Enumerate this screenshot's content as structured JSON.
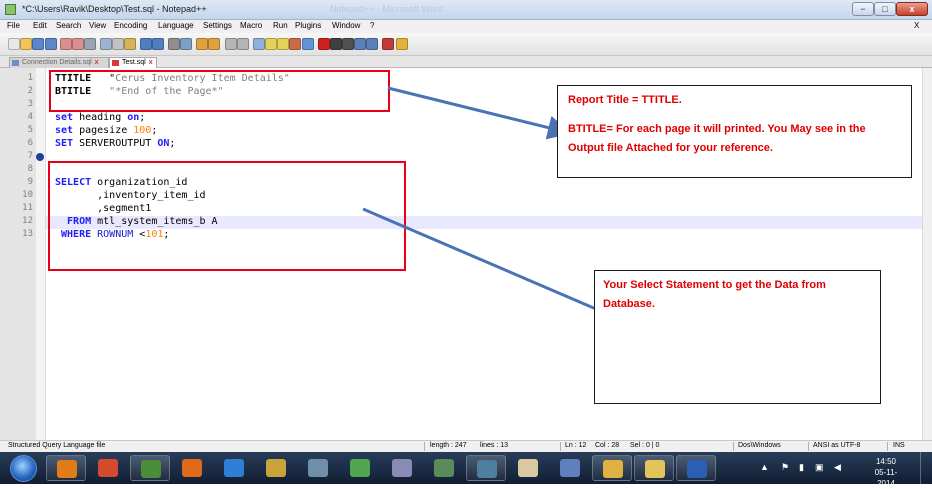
{
  "window": {
    "title": "*C:\\Users\\Ravik\\Desktop\\Test.sql - Notepad++",
    "background_title": "Notepad++ - Microsoft Word",
    "min_label": "−",
    "max_label": "□",
    "close_label": "x",
    "doc_close_label": "X"
  },
  "menu": [
    "File",
    "Edit",
    "Search",
    "View",
    "Encoding",
    "Language",
    "Settings",
    "Macro",
    "Run",
    "Plugins",
    "Window",
    "?"
  ],
  "toolbar_icons": [
    "new-file-icon",
    "open-file-icon",
    "save-icon",
    "save-all-icon",
    "close-icon",
    "close-all-icon",
    "print-icon",
    "cut-icon",
    "copy-icon",
    "paste-icon",
    "undo-icon",
    "redo-icon",
    "find-icon",
    "replace-icon",
    "zoom-in-icon",
    "zoom-out-icon",
    "sync-vertical-icon",
    "sync-horizontal-icon",
    "word-wrap-icon",
    "show-all-chars-icon",
    "indent-guide-icon",
    "document-map-icon",
    "function-list-icon",
    "record-macro-icon",
    "stop-record-icon",
    "play-macro-icon",
    "run-macro-multiple-icon",
    "save-macro-icon",
    "spell-check-icon",
    "color-picker-icon"
  ],
  "tabs": [
    {
      "label": "Connection Details.sql",
      "state": "inactive",
      "close": "x"
    },
    {
      "label": "Test.sql",
      "state": "active",
      "close": "x"
    }
  ],
  "editor": {
    "line_numbers": [
      "1",
      "2",
      "3",
      "4",
      "5",
      "6",
      "7",
      "8",
      "9",
      "10",
      "11",
      "12",
      "13"
    ],
    "lines": [
      [
        {
          "t": "TTITLE",
          "c": "bold"
        },
        {
          "t": "   \"",
          "c": ""
        },
        {
          "t": "Cerus Inventory Item Details\"",
          "c": "str"
        }
      ],
      [
        {
          "t": "BTITLE",
          "c": "bold"
        },
        {
          "t": "   \"*End of the Page*\"",
          "c": "str"
        }
      ],
      [],
      [
        {
          "t": "set",
          "c": "kw"
        },
        {
          "t": " heading ",
          "c": ""
        },
        {
          "t": "on",
          "c": "kw"
        },
        {
          "t": ";",
          "c": ""
        }
      ],
      [
        {
          "t": "set",
          "c": "kw"
        },
        {
          "t": " pagesize ",
          "c": ""
        },
        {
          "t": "100",
          "c": "num"
        },
        {
          "t": ";",
          "c": ""
        }
      ],
      [
        {
          "t": "SET",
          "c": "kw"
        },
        {
          "t": " SERVEROUTPUT ",
          "c": ""
        },
        {
          "t": "ON",
          "c": "kw"
        },
        {
          "t": ";",
          "c": ""
        }
      ],
      [],
      [],
      [
        {
          "t": "SELECT",
          "c": "kw"
        },
        {
          "t": " organization_id",
          "c": ""
        }
      ],
      [
        {
          "t": "       ,inventory_item_id",
          "c": ""
        }
      ],
      [
        {
          "t": "       ,segment1",
          "c": ""
        }
      ],
      [
        {
          "t": "  FROM",
          "c": "kw"
        },
        {
          "t": " mtl_system_items_b A",
          "c": ""
        }
      ],
      [
        {
          "t": " WHERE",
          "c": "kw"
        },
        {
          "t": " ROWNUM ",
          "c": "kw2"
        },
        {
          "t": "<",
          "c": ""
        },
        {
          "t": "101",
          "c": "num"
        },
        {
          "t": ";",
          "c": ""
        }
      ]
    ]
  },
  "annotations": {
    "note1_line1": "Report Title = TTITLE.",
    "note1_line2": "BTITLE= For each page it will printed. You May see in the  Output file Attached for your reference.",
    "note2_text": "Your Select Statement to get the Data from Database.",
    "box_color": "#e8001a",
    "arrow_color": "#4a73b5"
  },
  "status": {
    "lang": "Structured Query Language file",
    "length": "length : 247",
    "lines": "lines : 13",
    "ln": "Ln : 12",
    "col": "Col : 28",
    "sel": "Sel : 0 | 0",
    "eol": "Dos\\Windows",
    "encoding": "ANSI as UTF-8",
    "mode": "INS"
  },
  "taskbar": {
    "apps": [
      "outlook-icon",
      "chrome-icon",
      "project-icon",
      "firefox-icon",
      "internet-explorer-icon",
      "sql-developer-icon",
      "app-icon",
      "google-talk-icon",
      "search-app-icon",
      "database-icon",
      "server-icon",
      "teapot-icon",
      "network-icon",
      "java-icon",
      "file-explorer-icon",
      "word-icon"
    ],
    "time": "14:50",
    "date": "05-11-2014"
  }
}
